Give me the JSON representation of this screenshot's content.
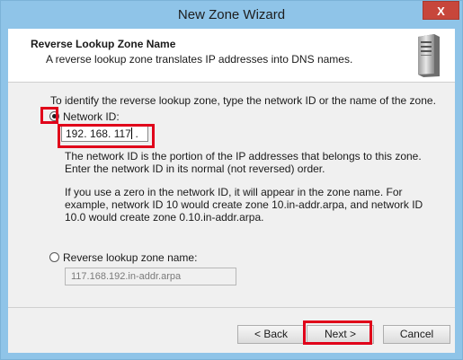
{
  "window": {
    "title": "New Zone Wizard",
    "close_glyph": "X"
  },
  "header": {
    "title": "Reverse Lookup Zone Name",
    "description": "A reverse lookup zone translates IP addresses into DNS names.",
    "icon": "server-icon"
  },
  "body": {
    "instruction": "To identify the reverse lookup zone, type the network ID or the name of the zone.",
    "network_id_option": {
      "label": "Network ID:",
      "selected": true
    },
    "network_id": {
      "octet1": "192",
      "octet2": "168",
      "octet3": "117",
      "octet4": "",
      "separator": "."
    },
    "help_para1": "The network ID is the portion of the IP addresses that belongs to this zone. Enter the network ID in its normal (not reversed) order.",
    "help_para2": "If you use a zero in the network ID, it will appear in the zone name. For example, network ID 10 would create zone 10.in-addr.arpa, and network ID 10.0 would create zone 0.10.in-addr.arpa.",
    "zone_name_option": {
      "label": "Reverse lookup zone name:",
      "selected": false
    },
    "zone_name_value": "117.168.192.in-addr.arpa"
  },
  "footer": {
    "back_label": "< Back",
    "next_label": "Next >",
    "cancel_label": "Cancel"
  },
  "colors": {
    "titlebar": "#8fc4e8",
    "close": "#c7463b",
    "highlight": "#e0001a"
  }
}
